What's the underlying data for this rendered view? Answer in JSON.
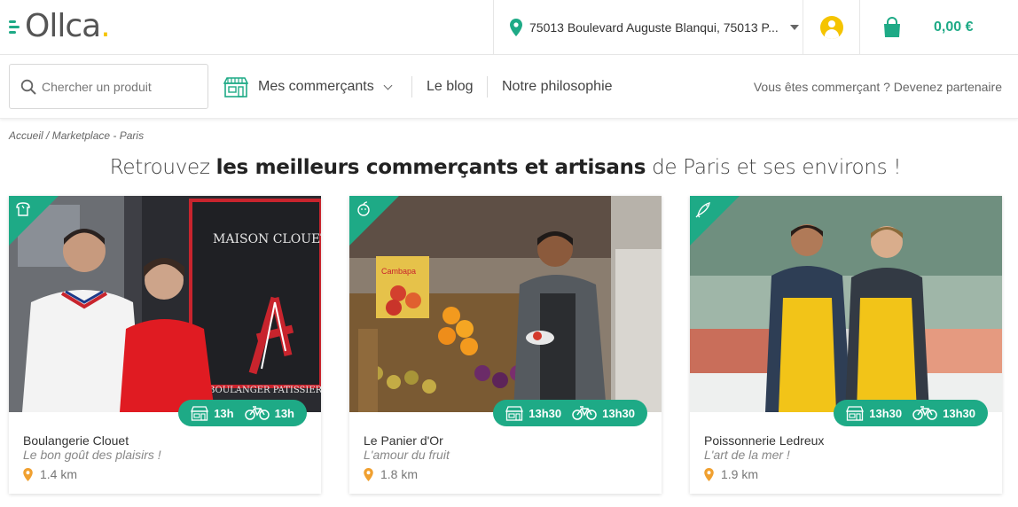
{
  "brand": {
    "name": "Ollca",
    "accent": "#1eaa86",
    "yellow": "#f5c400",
    "pin_orange": "#f0a030"
  },
  "header": {
    "address": "75013 Boulevard Auguste Blanqui, 75013 P...",
    "cart_total": "0,00 €",
    "icons": [
      "location-pin-icon",
      "chevron-down-icon",
      "user-avatar-icon",
      "shopping-bag-icon"
    ]
  },
  "nav": {
    "search_placeholder": "Chercher un produit",
    "merchants_label": "Mes commerçants",
    "blog_label": "Le blog",
    "philosophy_label": "Notre philosophie",
    "partner_label": "Vous êtes commerçant ? Devenez partenaire"
  },
  "breadcrumb": {
    "home": "Accueil",
    "separator": " / ",
    "current": "Marketplace - Paris"
  },
  "headline": {
    "prefix": "Retrouvez ",
    "bold": "les meilleurs commerçants et artisans",
    "suffix": " de Paris et ses environs !"
  },
  "merchants": [
    {
      "name": "Boulangerie Clouet",
      "slogan": "Le bon goût des plaisirs !",
      "distance": "1.4 km",
      "pickup_time": "13h",
      "delivery_time": "13h",
      "category_icon": "bread-icon",
      "photo_sign": "MAISON CLOUET",
      "photo_sign_2": "BOULANGER PATISSIER"
    },
    {
      "name": "Le Panier d'Or",
      "slogan": "L'amour du fruit",
      "distance": "1.8 km",
      "pickup_time": "13h30",
      "delivery_time": "13h30",
      "category_icon": "fruit-icon",
      "photo_sign": "Cambapa"
    },
    {
      "name": "Poissonnerie Ledreux",
      "slogan": "L'art de la mer !",
      "distance": "1.9 km",
      "pickup_time": "13h30",
      "delivery_time": "13h30",
      "category_icon": "fish-icon"
    }
  ]
}
